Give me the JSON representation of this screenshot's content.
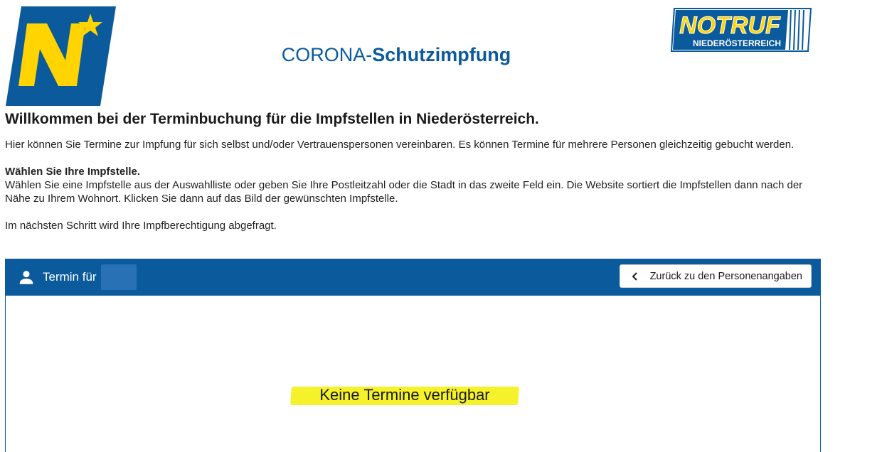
{
  "header": {
    "title_prefix": "CORONA-",
    "title_bold": "Schutzimpfung",
    "logo_left": "Niederösterreich logo",
    "logo_right_line1": "NOTRUF",
    "logo_right_line2": "NIEDERÖSTERREICH"
  },
  "intro": {
    "welcome": "Willkommen bei der Terminbuchung für die Impfstellen in Niederösterreich.",
    "paragraph1": "Hier können Sie Termine zur Impfung für sich selbst und/oder Vertrauenspersonen vereinbaren. Es können Termine für mehrere Personen gleichzeitig gebucht werden.",
    "heading2": "Wählen Sie Ihre Impfstelle.",
    "paragraph2": "Wählen Sie eine Impfstelle aus der Auswahlliste oder geben Sie Ihre Postleitzahl oder die Stadt in das zweite Feld ein. Die Website sortiert die Impfstellen dann nach der Nähe zu Ihrem Wohnort. Klicken Sie dann auf das Bild der gewünschten Impfstelle.",
    "paragraph3": "Im nächsten Schritt wird Ihre Impfberechtigung abgefragt."
  },
  "panel": {
    "title": "Termin für",
    "back_button": "Zurück zu den Personenangaben",
    "empty_message": "Keine Termine verfügbar"
  },
  "colors": {
    "brand_blue": "#0a5a9c",
    "highlight_yellow": "#f5f12a",
    "logo_yellow": "#ffd400"
  }
}
